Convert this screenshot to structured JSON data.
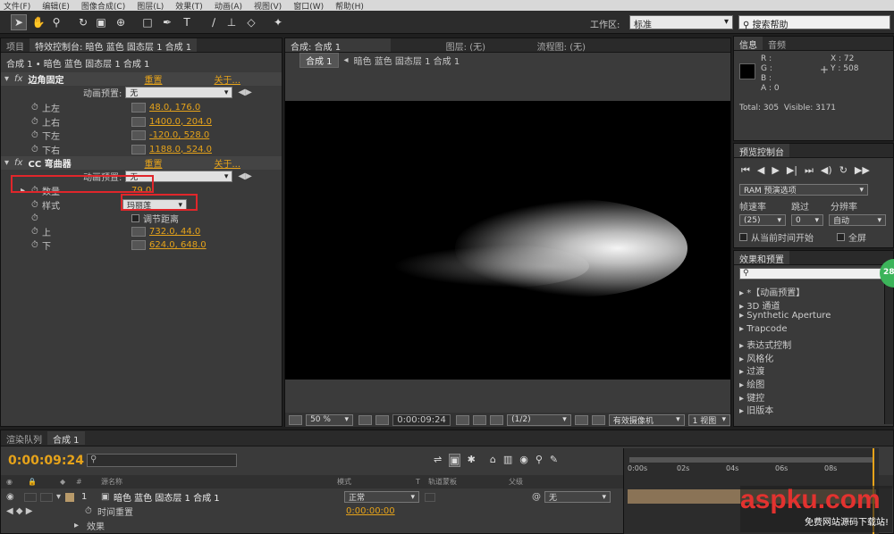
{
  "menu": [
    "文件(F)",
    "编辑(E)",
    "图像合成(C)",
    "图层(L)",
    "效果(T)",
    "动画(A)",
    "视图(V)",
    "窗口(W)",
    "帮助(H)"
  ],
  "toolbar": {
    "tool_icons": [
      "selection-tool-icon",
      "hand-tool-icon",
      "zoom-tool-icon",
      "rotate-tool-icon",
      "camera-tool-icon",
      "pan-behind-tool-icon",
      "shape-tool-icon",
      "pen-tool-icon",
      "text-tool-icon",
      "brush-tool-icon",
      "clone-stamp-tool-icon",
      "eraser-tool-icon",
      "puppet-tool-icon"
    ],
    "workspace_label": "工作区:",
    "workspace_value": "标准",
    "search_value": "搜索帮助"
  },
  "left_panel": {
    "tabs": [
      "项目",
      "特效控制台: 暗色 蓝色 固态层 1 合成 1"
    ],
    "breadcrumb": "合成 1 • 暗色 蓝色 固态层 1 合成 1",
    "effect1": {
      "name": "边角固定",
      "reset": "重置",
      "about": "关于...",
      "preset_label": "动画预置:",
      "preset_value": "无",
      "params": [
        {
          "label": "上左",
          "value": "48.0, 176.0"
        },
        {
          "label": "上右",
          "value": "1400.0, 204.0"
        },
        {
          "label": "下左",
          "value": "-120.0, 528.0"
        },
        {
          "label": "下右",
          "value": "1188.0, 524.0"
        }
      ]
    },
    "effect2": {
      "name": "CC 弯曲器",
      "reset": "重置",
      "about": "关于...",
      "preset_label": "动画预置:",
      "preset_value": "无",
      "amount_label": "数量",
      "amount_value": "79.0",
      "style_label": "样式",
      "style_value": "玛丽莲",
      "adjust_label": "调节距离",
      "top_label": "上",
      "top_value": "732.0, 44.0",
      "bottom_label": "下",
      "bottom_value": "624.0, 648.0"
    }
  },
  "comp_panel": {
    "tabs": [
      "合成: 合成 1",
      "图层: (无)",
      "流程图: (无)"
    ],
    "comp_button": "合成 1",
    "breadcrumb": "暗色 蓝色 固态层 1 合成 1",
    "zoom": "50 %",
    "timecode": "0:00:09:24",
    "resolution": "(1/2)",
    "camera": "有效摄像机",
    "view": "1 视图"
  },
  "info_panel": {
    "tabs": [
      "信息",
      "音频"
    ],
    "rgba": [
      "R :",
      "G :",
      "B :",
      "A : 0"
    ],
    "x": "X : 72",
    "y": "Y : 508",
    "total": "Total: 305",
    "visible": "Visible: 3171"
  },
  "preview_panel": {
    "tab": "预览控制台",
    "ram_preview": "RAM 预演选项",
    "frame_rate_label": "帧速率",
    "skip_label": "跳过",
    "resolution_label": "分辨率",
    "frame_rate_value": "(25)",
    "skip_value": "0",
    "resolution_value": "自动",
    "from_current": "从当前时间开始",
    "fullscreen": "全屏"
  },
  "effects_panel": {
    "tab": "效果和预置",
    "items": [
      "*【动画预置】",
      "3D 通道",
      "Synthetic Aperture",
      "Trapcode",
      "表达式控制",
      "风格化",
      "过渡",
      "绘图",
      "键控",
      "旧版本"
    ]
  },
  "badge": "28",
  "timeline": {
    "tabs": [
      "渲染队列",
      "合成 1"
    ],
    "timecode": "0:00:09:24",
    "columns": {
      "source": "源名称",
      "mode": "模式",
      "t": "T",
      "trkmat": "轨道蒙板",
      "parent": "父级"
    },
    "layer": {
      "index": "1",
      "name": "暗色 蓝色 固态层 1 合成 1",
      "mode": "正常",
      "parent": "无",
      "time_remap_label": "时间重置",
      "time_remap_value": "0:00:00:00",
      "effects_label": "效果"
    },
    "ruler": [
      "0:00s",
      "02s",
      "04s",
      "06s",
      "08s"
    ]
  },
  "watermark": {
    "logo": "aspku.com",
    "tagline": "免费网站源码下载站!"
  }
}
